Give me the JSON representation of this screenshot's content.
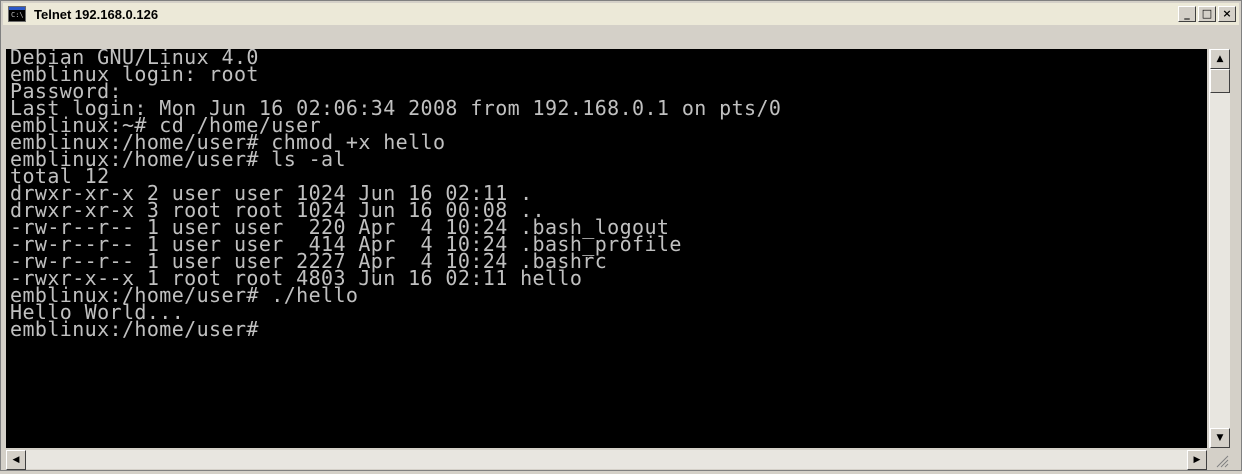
{
  "window": {
    "title": "Telnet 192.168.0.126",
    "icon": "console-icon",
    "icon_text": "C:\\"
  },
  "controls": {
    "minimize": "_",
    "maximize": "□",
    "close": "×"
  },
  "terminal": {
    "lines": [
      "Debian GNU/Linux 4.0",
      "emblinux login: root",
      "Password:",
      "Last login: Mon Jun 16 02:06:34 2008 from 192.168.0.1 on pts/0",
      "emblinux:~# cd /home/user",
      "emblinux:/home/user# chmod +x hello",
      "emblinux:/home/user# ls -al",
      "total 12",
      "drwxr-xr-x 2 user user 1024 Jun 16 02:11 .",
      "drwxr-xr-x 3 root root 1024 Jun 16 00:08 ..",
      "-rw-r--r-- 1 user user  220 Apr  4 10:24 .bash_logout",
      "-rw-r--r-- 1 user user  414 Apr  4 10:24 .bash_profile",
      "-rw-r--r-- 1 user user 2227 Apr  4 10:24 .bashrc",
      "-rwxr-x--x 1 root root 4803 Jun 16 02:11 hello",
      "emblinux:/home/user# ./hello",
      "Hello World...",
      "emblinux:/home/user#"
    ]
  },
  "scrollbar": {
    "up": "▲",
    "down": "▼",
    "left": "◀",
    "right": "▶"
  },
  "colors": {
    "foreground": "#c0c0c0",
    "background": "#000000"
  }
}
